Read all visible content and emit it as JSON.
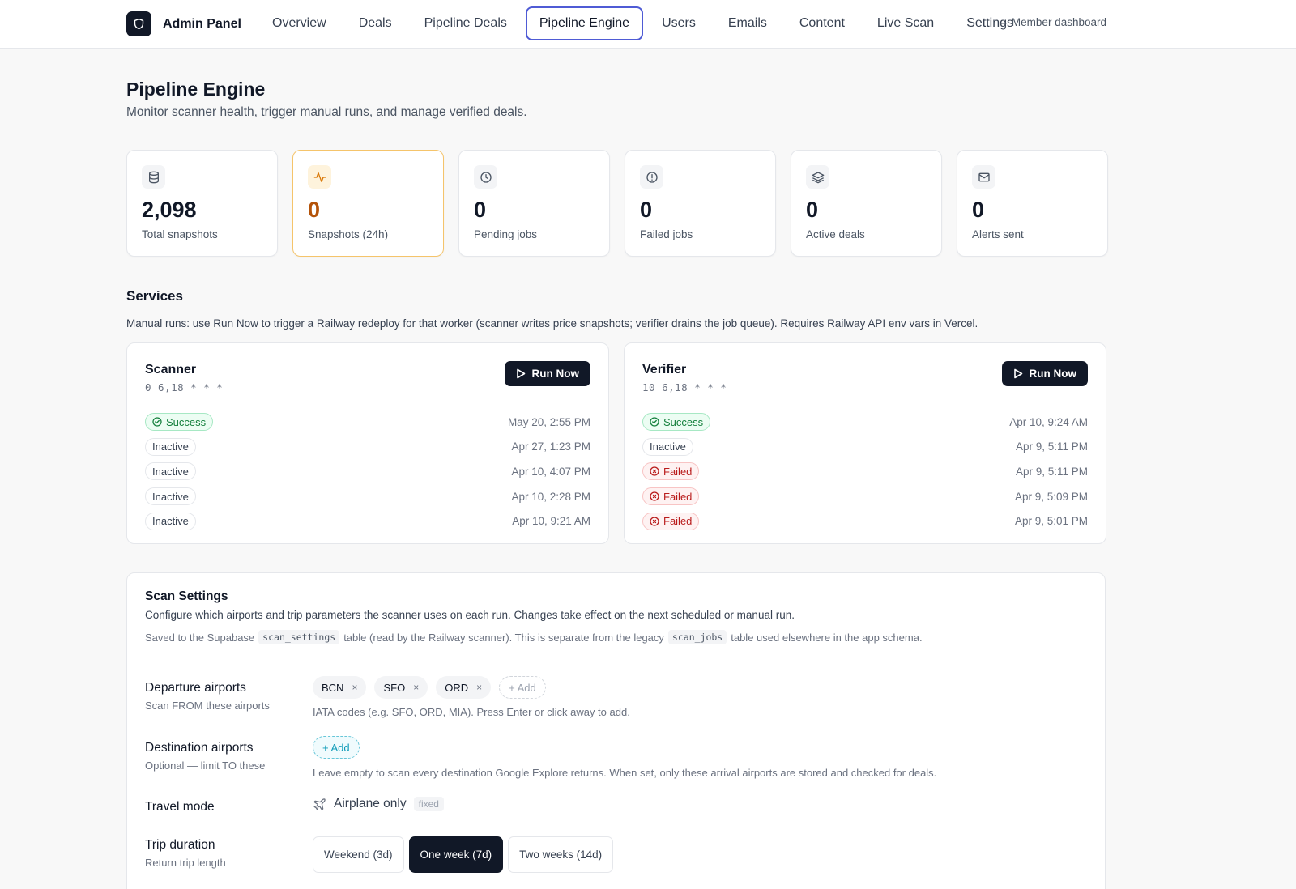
{
  "brand": {
    "title": "Admin Panel",
    "logo_icon": "shield-icon"
  },
  "nav": {
    "tabs": [
      {
        "label": "Overview"
      },
      {
        "label": "Deals"
      },
      {
        "label": "Pipeline Deals"
      },
      {
        "label": "Pipeline Engine",
        "active": true
      },
      {
        "label": "Users"
      },
      {
        "label": "Emails"
      },
      {
        "label": "Content"
      },
      {
        "label": "Live Scan"
      },
      {
        "label": "Settings"
      }
    ],
    "member_link": "← Member dashboard"
  },
  "header": {
    "title": "Pipeline Engine",
    "subtitle": "Monitor scanner health, trigger manual runs, and manage verified deals."
  },
  "stats": [
    {
      "value": "2,098",
      "label": "Total snapshots",
      "icon": "database-icon"
    },
    {
      "value": "0",
      "label": "Snapshots (24h)",
      "icon": "activity-icon"
    },
    {
      "value": "0",
      "label": "Pending jobs",
      "icon": "clock-icon"
    },
    {
      "value": "0",
      "label": "Failed jobs",
      "icon": "alert-circle-icon"
    },
    {
      "value": "0",
      "label": "Active deals",
      "icon": "layers-icon"
    },
    {
      "value": "0",
      "label": "Alerts sent",
      "icon": "mail-icon"
    }
  ],
  "services": {
    "title": "Services",
    "note": "Manual runs: use Run Now to trigger a Railway redeploy for that worker (scanner writes price snapshots; verifier drains the job queue). Requires Railway API env vars in Vercel.",
    "run_label": "Run Now",
    "items": [
      {
        "name": "Scanner",
        "cron": "0 6,18 * * *",
        "runs": [
          {
            "status": "Success",
            "time": "May 20, 2:55 PM"
          },
          {
            "status": "Inactive",
            "time": "Apr 27, 1:23 PM"
          },
          {
            "status": "Inactive",
            "time": "Apr 10, 4:07 PM"
          },
          {
            "status": "Inactive",
            "time": "Apr 10, 2:28 PM"
          },
          {
            "status": "Inactive",
            "time": "Apr 10, 9:21 AM"
          }
        ]
      },
      {
        "name": "Verifier",
        "cron": "10 6,18 * * *",
        "runs": [
          {
            "status": "Success",
            "time": "Apr 10, 9:24 AM"
          },
          {
            "status": "Inactive",
            "time": "Apr 9, 5:11 PM"
          },
          {
            "status": "Failed",
            "time": "Apr 9, 5:11 PM"
          },
          {
            "status": "Failed",
            "time": "Apr 9, 5:09 PM"
          },
          {
            "status": "Failed",
            "time": "Apr 9, 5:01 PM"
          }
        ]
      }
    ]
  },
  "scan_settings": {
    "title": "Scan Settings",
    "description": "Configure which airports and trip parameters the scanner uses on each run. Changes take effect on the next scheduled or manual run.",
    "note_pre": "Saved to the Supabase",
    "note_code1": "scan_settings",
    "note_mid": "table (read by the Railway scanner). This is separate from the legacy",
    "note_code2": "scan_jobs",
    "note_post": "table used elsewhere in the app schema.",
    "departure": {
      "label": "Departure airports",
      "sub": "Scan FROM these airports",
      "chips": [
        "BCN",
        "SFO",
        "ORD"
      ],
      "chip_remove": "×",
      "add_label": "+ Add",
      "help": "IATA codes (e.g. SFO, ORD, MIA). Press Enter or click away to add."
    },
    "destination": {
      "label": "Destination airports",
      "sub": "Optional — limit TO these",
      "add_label": "+ Add",
      "help": "Leave empty to scan every destination Google Explore returns. When set, only these arrival airports are stored and checked for deals."
    },
    "travel_mode": {
      "label": "Travel mode",
      "value": "Airplane only",
      "tag": "fixed",
      "icon": "plane-icon"
    },
    "trip_duration": {
      "label": "Trip duration",
      "sub": "Return trip length",
      "options": [
        {
          "label": "Weekend (3d)"
        },
        {
          "label": "One week (7d)",
          "selected": true
        },
        {
          "label": "Two weeks (14d)"
        }
      ]
    }
  }
}
